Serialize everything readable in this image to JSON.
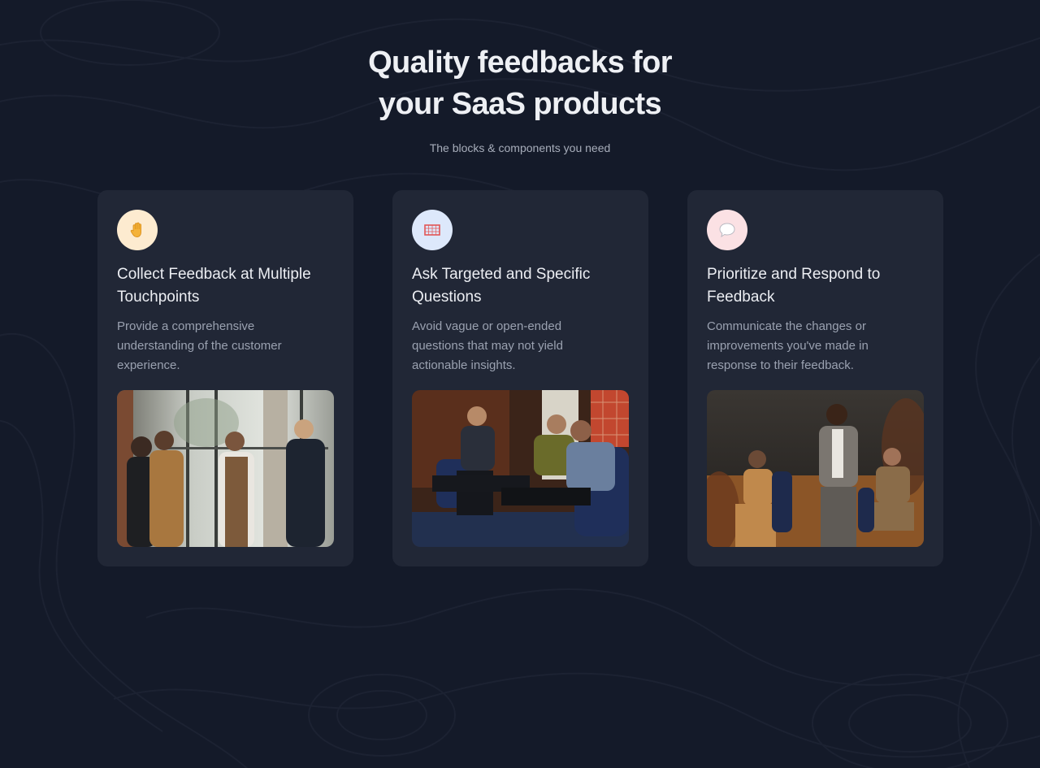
{
  "hero": {
    "title_line1": "Quality feedbacks for",
    "title_line2": "your SaaS products",
    "subtitle": "The blocks & components you need"
  },
  "colors": {
    "background": "#141a29",
    "card": "#212736",
    "title": "#eef0f4",
    "muted": "#9aa1b0"
  },
  "cards": [
    {
      "icon": "raised-hand-icon",
      "icon_bg": "#fdebd0",
      "title": "Collect Feedback at Multiple Touchpoints",
      "text": "Provide a comprehensive understanding of the customer experience.",
      "photo": "photo-people-talking-by-window"
    },
    {
      "icon": "goal-net-icon",
      "icon_bg": "#dde8fb",
      "title": "Ask Targeted and Specific Questions",
      "text": "Avoid vague or open-ended questions that may not yield actionable insights.",
      "photo": "photo-panel-discussion"
    },
    {
      "icon": "speech-bubble-icon",
      "icon_bg": "#fbe1e4",
      "title": "Prioritize and Respond to Feedback",
      "text": "Communicate the changes or improvements you've made in response to their feedback.",
      "photo": "photo-speaker-on-stage"
    }
  ]
}
